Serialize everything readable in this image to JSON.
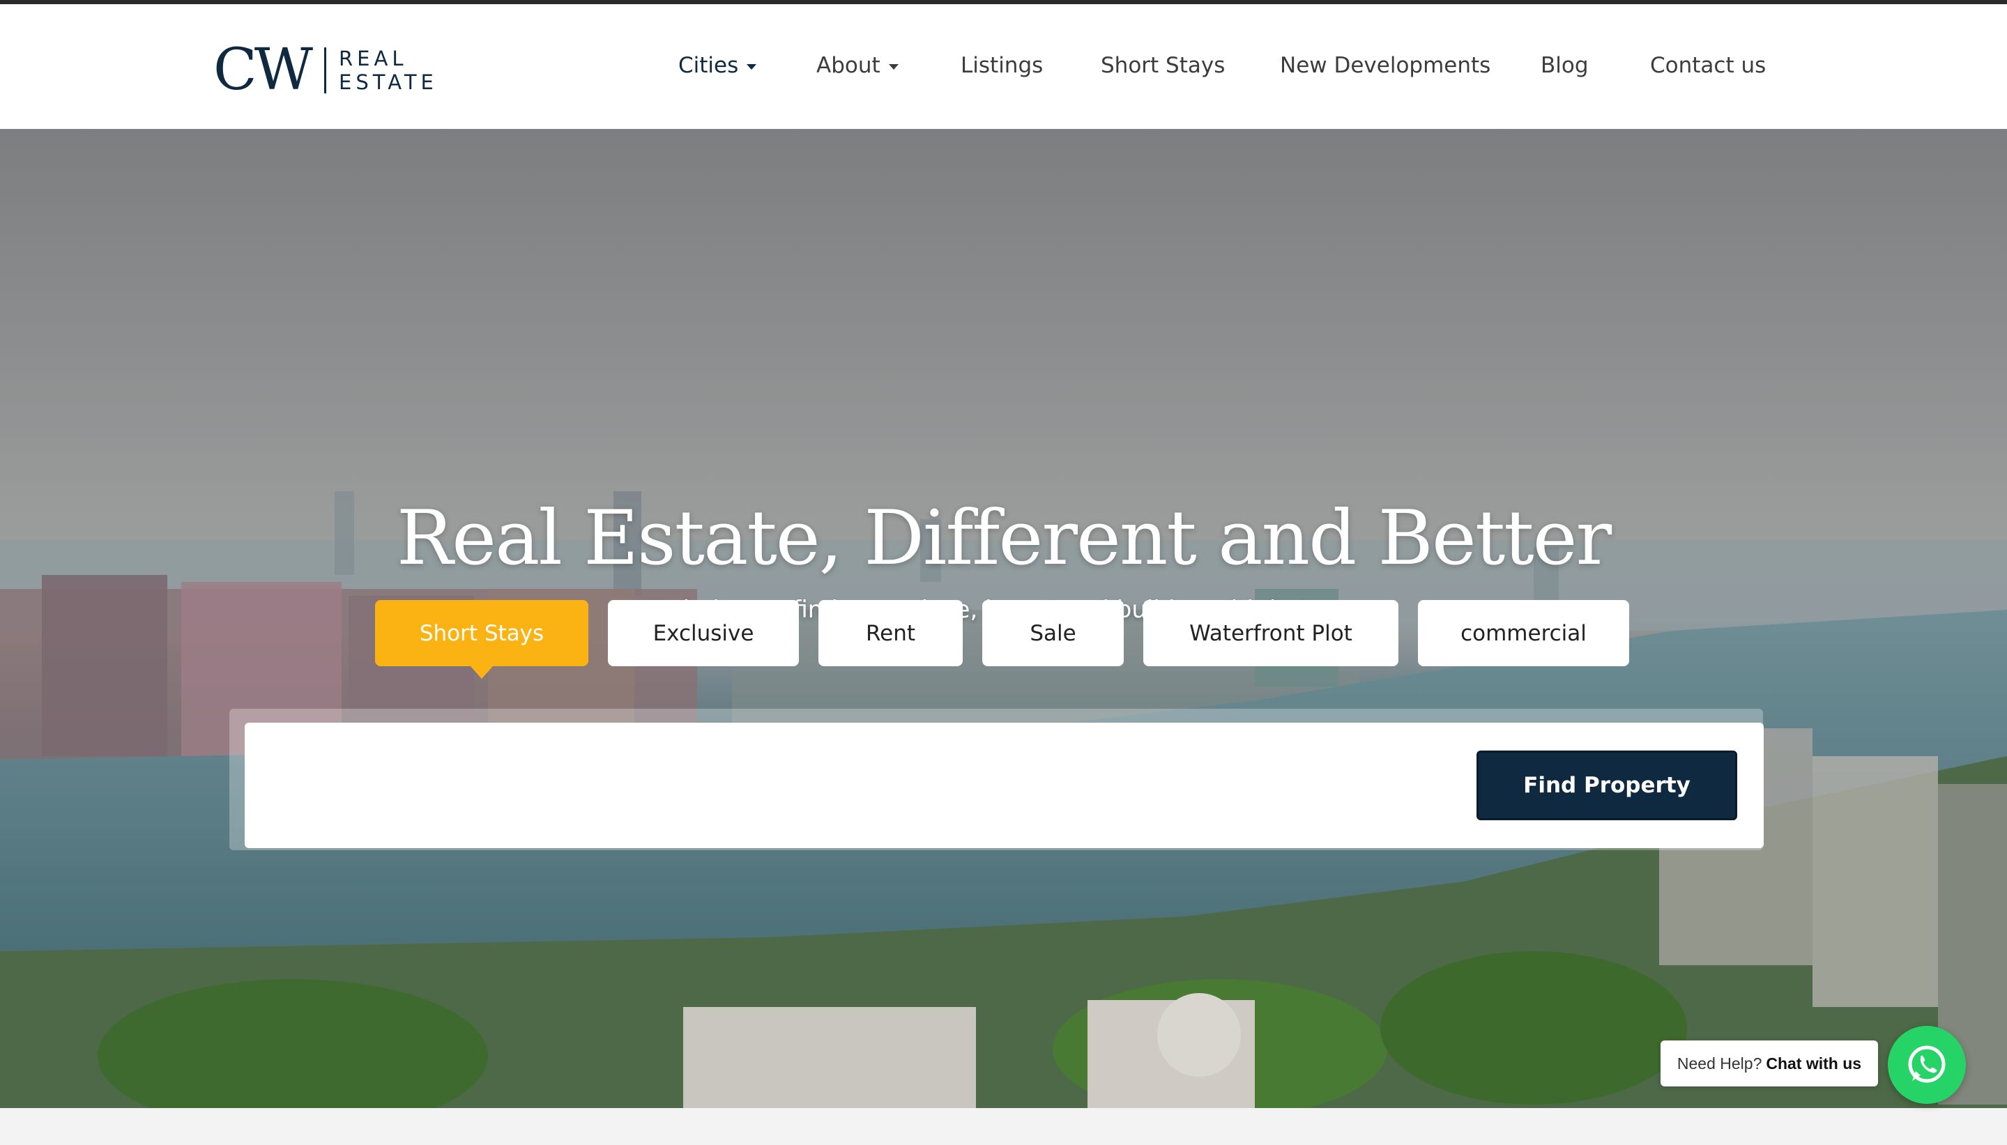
{
  "brand": {
    "mark": "CW",
    "line1": "REAL",
    "line2": "ESTATE"
  },
  "nav": {
    "items": [
      {
        "label": "Cities",
        "dropdown": true,
        "active": true
      },
      {
        "label": "About",
        "dropdown": true,
        "active": false
      },
      {
        "label": "Listings",
        "dropdown": false,
        "active": false
      },
      {
        "label": "Short Stays",
        "dropdown": false,
        "active": false
      },
      {
        "label": "New Developments",
        "dropdown": false,
        "active": false
      },
      {
        "label": "Blog",
        "dropdown": false,
        "active": false
      },
      {
        "label": "Contact us",
        "dropdown": false,
        "active": false
      }
    ]
  },
  "hero": {
    "title": "Real Estate, Different and Better",
    "subtitle": "We help you find your place, invest and build wealth in Lagos"
  },
  "tabs": [
    {
      "label": "Short Stays",
      "active": true
    },
    {
      "label": "Exclusive",
      "active": false
    },
    {
      "label": "Rent",
      "active": false
    },
    {
      "label": "Sale",
      "active": false
    },
    {
      "label": "Waterfront Plot",
      "active": false
    },
    {
      "label": "commercial",
      "active": false
    }
  ],
  "search": {
    "value": "",
    "button_label": "Find Property"
  },
  "chat": {
    "prefix": "Need Help?",
    "strong": "Chat with us",
    "icon": "whatsapp-icon"
  },
  "colors": {
    "accent": "#fbb313",
    "brand_navy": "#0f2a40",
    "whatsapp_green": "#25d366"
  }
}
